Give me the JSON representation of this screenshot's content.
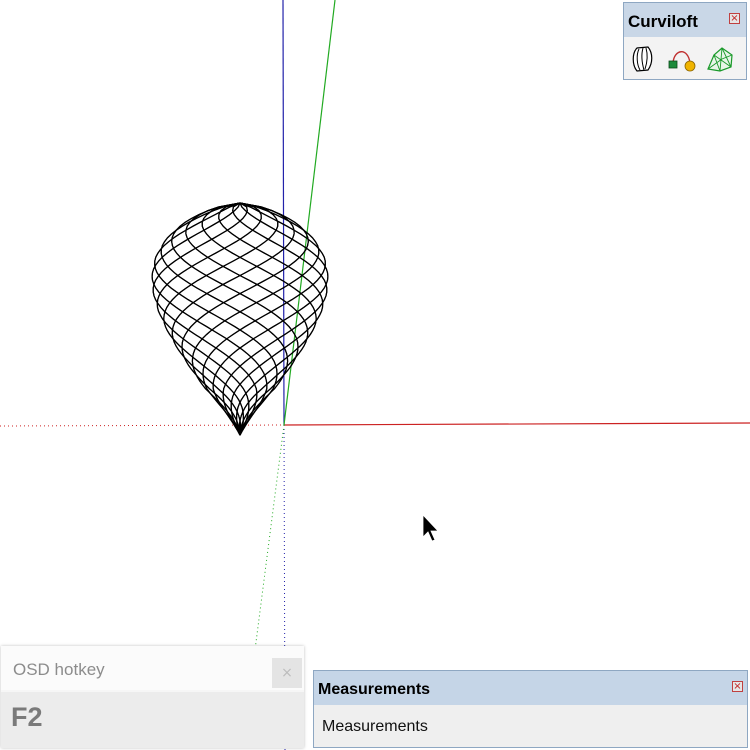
{
  "toolbar": {
    "title": "Curviloft",
    "close_glyph": "×",
    "buttons": [
      {
        "name": "loft-by-spline-icon"
      },
      {
        "name": "skinning-icon"
      },
      {
        "name": "loft-along-path-icon"
      }
    ]
  },
  "osd": {
    "title": "OSD hotkey",
    "close_glyph": "×",
    "key": "F2"
  },
  "measurements": {
    "title": "Measurements",
    "close_glyph": "×",
    "value": "Measurements"
  },
  "scene": {
    "axis_colors": {
      "red": "#cc2222",
      "green": "#22aa22",
      "blue": "#2222aa"
    },
    "model": "twisted lattice onion dome wireframe"
  }
}
